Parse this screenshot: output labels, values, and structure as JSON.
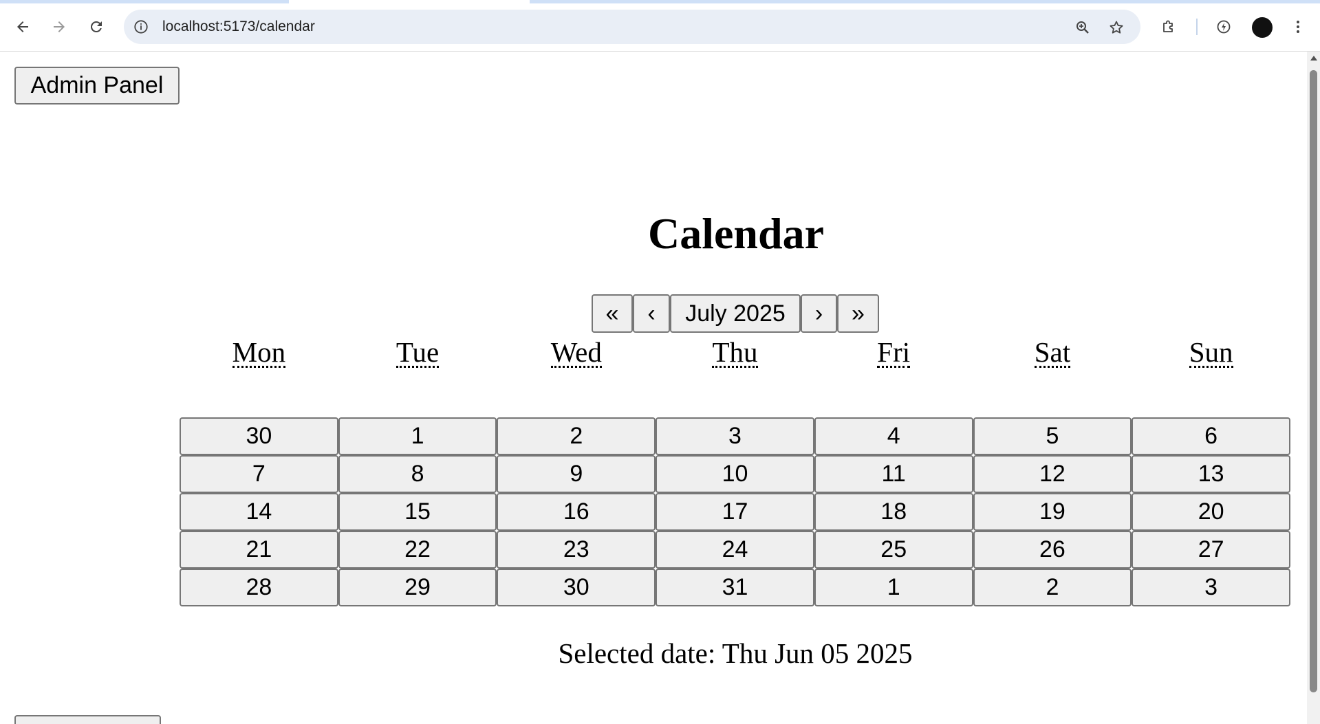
{
  "browser": {
    "url": "localhost:5173/calendar",
    "icons": {
      "back": "arrow-left-icon",
      "forward": "arrow-right-icon",
      "reload": "reload-icon",
      "site_info": "info-icon",
      "zoom": "zoom-in-icon",
      "bookmark": "star-icon",
      "extensions": "puzzle-icon",
      "performance": "bolt-icon",
      "menu": "kebab-menu-icon"
    }
  },
  "page": {
    "admin_button_label": "Admin Panel",
    "title": "Calendar",
    "selected_date_text": "Selected date: Thu Jun 05 2025",
    "bottom_button_label": ""
  },
  "calendar": {
    "navigation": {
      "prev2": "«",
      "prev": "‹",
      "label": "July 2025",
      "next": "›",
      "next2": "»"
    },
    "weekdays": [
      "Mon",
      "Tue",
      "Wed",
      "Thu",
      "Fri",
      "Sat",
      "Sun"
    ],
    "days": [
      "30",
      "1",
      "2",
      "3",
      "4",
      "5",
      "6",
      "7",
      "8",
      "9",
      "10",
      "11",
      "12",
      "13",
      "14",
      "15",
      "16",
      "17",
      "18",
      "19",
      "20",
      "21",
      "22",
      "23",
      "24",
      "25",
      "26",
      "27",
      "28",
      "29",
      "30",
      "31",
      "1",
      "2",
      "3"
    ]
  },
  "colors": {
    "button_bg": "#efefef",
    "button_border": "#767676",
    "omnibox_bg": "#e9eef6"
  }
}
